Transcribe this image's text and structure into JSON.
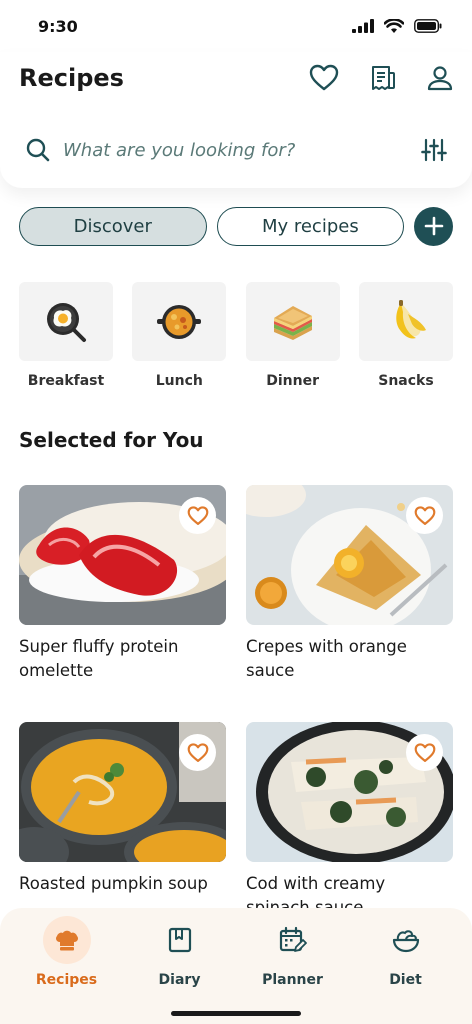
{
  "status_bar": {
    "time": "9:30"
  },
  "header": {
    "title": "Recipes",
    "icons": [
      "heart-icon",
      "shopping-list-icon",
      "profile-icon"
    ]
  },
  "search": {
    "placeholder": "What are you looking for?"
  },
  "tabs": [
    {
      "label": "Discover",
      "active": true
    },
    {
      "label": "My recipes",
      "active": false
    }
  ],
  "categories": [
    {
      "label": "Breakfast",
      "icon": "frying-pan-egg-icon"
    },
    {
      "label": "Lunch",
      "icon": "paella-pan-icon"
    },
    {
      "label": "Dinner",
      "icon": "sandwich-icon"
    },
    {
      "label": "Snacks",
      "icon": "banana-icon"
    }
  ],
  "section_title": "Selected for You",
  "recipes": [
    {
      "title": "Super fluffy protein omelette"
    },
    {
      "title": "Crepes with orange sauce"
    },
    {
      "title": "Roasted pumpkin soup"
    },
    {
      "title": "Cod with creamy spinach sauce"
    }
  ],
  "bottom_nav": [
    {
      "label": "Recipes",
      "active": true
    },
    {
      "label": "Diary",
      "active": false
    },
    {
      "label": "Planner",
      "active": false
    },
    {
      "label": "Diet",
      "active": false
    }
  ],
  "colors": {
    "brand_dark": "#1f4f55",
    "accent_orange": "#d96b1c",
    "tab_active_bg": "#d6dfe0",
    "nav_bg": "#fbf6f0"
  }
}
